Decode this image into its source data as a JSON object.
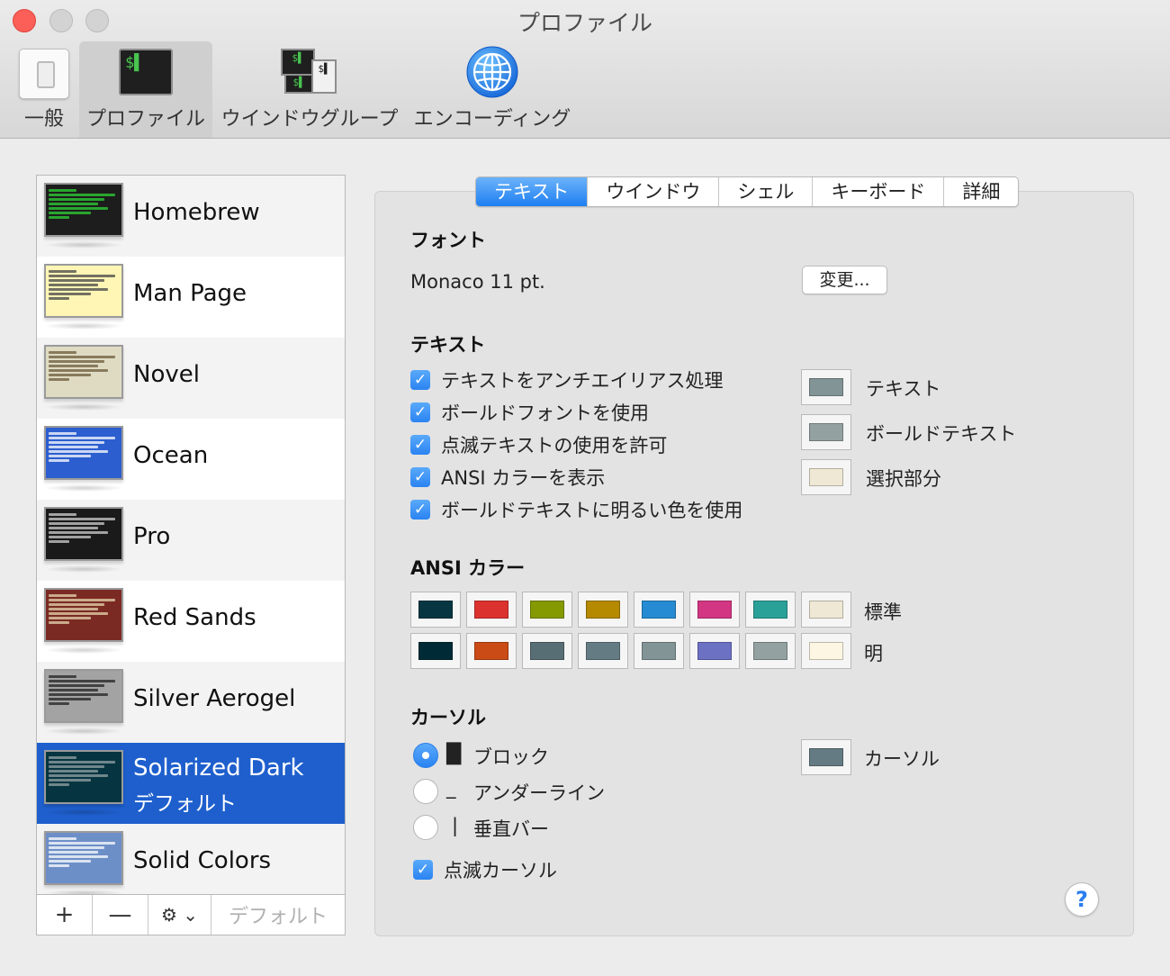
{
  "window": {
    "title": "プロファイル"
  },
  "toolbar": {
    "general": "一般",
    "profiles": "プロファイル",
    "window_groups": "ウインドウグループ",
    "encoding": "エンコーディング",
    "profile_icon_text": "$▌",
    "wg_icon_text": "$▌"
  },
  "profiles": [
    {
      "name": "Homebrew",
      "theme_bg": "#1d1d1d",
      "theme_fg": "#2ed336"
    },
    {
      "name": "Man Page",
      "theme_bg": "#fff6b6",
      "theme_fg": "#444444"
    },
    {
      "name": "Novel",
      "theme_bg": "#dfdbc3",
      "theme_fg": "#6b5a3a"
    },
    {
      "name": "Ocean",
      "theme_bg": "#2c5ecf",
      "theme_fg": "#ffffff"
    },
    {
      "name": "Pro",
      "theme_bg": "#1a1a1a",
      "theme_fg": "#d0d0d0"
    },
    {
      "name": "Red Sands",
      "theme_bg": "#7a2a22",
      "theme_fg": "#e6d7b0"
    },
    {
      "name": "Silver Aerogel",
      "theme_bg": "#a3a3a3",
      "theme_fg": "#222222"
    },
    {
      "name": "Solarized Dark",
      "subtitle": "デフォルト",
      "selected": true,
      "theme_bg": "#063541",
      "theme_fg": "#94a3a5"
    },
    {
      "name": "Solid Colors",
      "theme_bg": "#6d8fc8",
      "theme_fg": "#ffffff"
    }
  ],
  "list_toolbar": {
    "add": "+",
    "remove": "—",
    "gear": "⚙ ⌄",
    "default": "デフォルト"
  },
  "tabs": [
    "テキスト",
    "ウインドウ",
    "シェル",
    "キーボード",
    "詳細"
  ],
  "active_tab": "テキスト",
  "font_section": {
    "title": "フォント",
    "value": "Monaco 11 pt.",
    "change_button": "変更..."
  },
  "text_section": {
    "title": "テキスト",
    "options": [
      {
        "label": "テキストをアンチエイリアス処理",
        "checked": true
      },
      {
        "label": "ボールドフォントを使用",
        "checked": true
      },
      {
        "label": "点滅テキストの使用を許可",
        "checked": true
      },
      {
        "label": "ANSI カラーを表示",
        "checked": true
      },
      {
        "label": "ボールドテキストに明るい色を使用",
        "checked": true
      }
    ],
    "colors": [
      {
        "label": "テキスト",
        "color": "#839496"
      },
      {
        "label": "ボールドテキスト",
        "color": "#93a1a1"
      },
      {
        "label": "選択部分",
        "color": "#eee8d5"
      }
    ]
  },
  "ansi_section": {
    "title": "ANSI カラー",
    "normal_label": "標準",
    "bright_label": "明",
    "normal": [
      "#073642",
      "#dc322f",
      "#859900",
      "#b58900",
      "#268bd2",
      "#d33682",
      "#2aa198",
      "#eee8d5"
    ],
    "bright": [
      "#002b36",
      "#cb4b16",
      "#586e75",
      "#657b83",
      "#839496",
      "#6c71c4",
      "#93a1a1",
      "#fdf6e3"
    ]
  },
  "cursor_section": {
    "title": "カーソル",
    "options": [
      {
        "glyph": "█",
        "label": "ブロック",
        "selected": true
      },
      {
        "glyph": "_",
        "label": "アンダーライン",
        "selected": false
      },
      {
        "glyph": "|",
        "label": "垂直バー",
        "selected": false
      }
    ],
    "blink_label": "点滅カーソル",
    "blink_checked": true,
    "color_label": "カーソル",
    "color": "#657b83"
  },
  "help": "?"
}
